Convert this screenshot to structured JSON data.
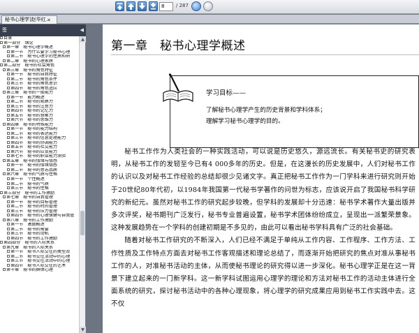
{
  "toolbar": {
    "current_page": "8",
    "total_pages": "/ 287"
  },
  "tab": {
    "title": "秘书心理学]赵华红...",
    "close": "✕"
  },
  "sidebar": {
    "title": "签",
    "collapse": "◀",
    "items": [
      {
        "level": 0,
        "exp": true,
        "label": "目录"
      },
      {
        "level": 0,
        "exp": true,
        "label": "第一部分　绪论"
      },
      {
        "level": 1,
        "exp": true,
        "label": "第一章　秘书心理学概述"
      },
      {
        "level": 2,
        "exp": true,
        "label": "第一节　为什么要学习秘书心理"
      },
      {
        "level": 2,
        "exp": true,
        "label": "第二节　秘书心理学的性质和研"
      },
      {
        "level": 1,
        "exp": true,
        "label": "第二章　秘书的心理素质"
      },
      {
        "level": 0,
        "exp": true,
        "label": "第二部分　秘书的社会角色"
      },
      {
        "level": 1,
        "exp": true,
        "label": "第三章　秘书的角色特征"
      },
      {
        "level": 2,
        "exp": true,
        "label": "第一节　秘书的自我特征"
      },
      {
        "level": 2,
        "exp": true,
        "label": "第二节　秘书的角色条件"
      },
      {
        "level": 2,
        "exp": true,
        "label": "第三节　秘书的角色意识"
      },
      {
        "level": 2,
        "exp": true,
        "label": "第四节　秘书的角色适应"
      },
      {
        "level": 1,
        "exp": true,
        "label": "第三章　秘书的一般能力"
      },
      {
        "level": 2,
        "exp": true,
        "label": "第一节　能力概述"
      },
      {
        "level": 2,
        "exp": true,
        "label": "第二节　秘书的观察力"
      },
      {
        "level": 2,
        "exp": true,
        "label": "第三节　秘书的注意力"
      },
      {
        "level": 2,
        "exp": true,
        "label": "第四节　秘书的记忆力"
      },
      {
        "level": 2,
        "exp": true,
        "label": "第五节　秘书的想象力"
      },
      {
        "level": 2,
        "exp": true,
        "label": "第六节　秘书的思维力"
      },
      {
        "level": 1,
        "exp": true,
        "label": "第四章　秘书的特殊能力"
      },
      {
        "level": 2,
        "exp": true,
        "label": "第一节　秘书的能力结构"
      },
      {
        "level": 2,
        "exp": true,
        "label": "第二节　秘书的表达能力"
      },
      {
        "level": 2,
        "exp": true,
        "label": "第三节　秘书的信息处理能力"
      },
      {
        "level": 2,
        "exp": true,
        "label": "第四节　秘书的协调能力"
      },
      {
        "level": 2,
        "exp": true,
        "label": "第五节　秘书的社交能力"
      },
      {
        "level": 2,
        "exp": true,
        "label": "第六节　秘书的应变能力"
      },
      {
        "level": 2,
        "exp": true,
        "label": "第七节　秘书的职业能力测验"
      },
      {
        "level": 1,
        "exp": true,
        "label": "第五章　秘书的情绪与情感"
      },
      {
        "level": 2,
        "exp": true,
        "label": "第一节　秘书的情绪情感"
      },
      {
        "level": 2,
        "exp": true,
        "label": "第二节　秘书的意志品质"
      },
      {
        "level": 1,
        "exp": true,
        "label": "第六章　秘书的气质与性格"
      },
      {
        "level": 2,
        "exp": true,
        "label": "第一节　个性概述"
      },
      {
        "level": 2,
        "exp": true,
        "label": "第二节　秘书的气质"
      },
      {
        "level": 2,
        "exp": true,
        "label": "第三节　秘书的性格"
      },
      {
        "level": 0,
        "exp": true,
        "label": "第三部分　秘书的工作激励"
      },
      {
        "level": 1,
        "exp": true,
        "label": "第七章　秘书的自我管理"
      },
      {
        "level": 2,
        "exp": true,
        "label": "第一节　秘书的目标管理"
      },
      {
        "level": 2,
        "exp": true,
        "label": "第二节　秘书的时间管理"
      },
      {
        "level": 2,
        "exp": true,
        "label": "第三节　秘书的压力管理"
      },
      {
        "level": 2,
        "exp": true,
        "label": "第四节　秘书的心理保健与自我管"
      },
      {
        "level": 1,
        "exp": true,
        "label": "第八章　秘书的工作激励"
      },
      {
        "level": 2,
        "exp": true,
        "label": "第一节　激励概述"
      },
      {
        "level": 2,
        "exp": true,
        "label": "第二节　秘书的需要"
      },
      {
        "level": 2,
        "exp": true,
        "label": "第三节　秘书的动机"
      },
      {
        "level": 2,
        "exp": true,
        "label": "第四节　秘书的工作激励"
      },
      {
        "level": 0,
        "exp": true,
        "label": "第四部分　秘书的人际关系"
      },
      {
        "level": 1,
        "exp": true,
        "label": "第九章　秘书的人际关系"
      },
      {
        "level": 2,
        "exp": true,
        "label": "第一节　秘书人际交往的类型及"
      },
      {
        "level": 2,
        "exp": true,
        "label": "第二节　秘书交往活动中的心理"
      },
      {
        "level": 2,
        "exp": true,
        "label": "第三节　秘书交往活动中的心理"
      },
      {
        "level": 2,
        "exp": true,
        "label": "第四节　秘书人际交往的艺术"
      },
      {
        "level": 1,
        "exp": true,
        "label": "第十章　秘书的群体心理"
      }
    ]
  },
  "page": {
    "chapter_title": "第一章　秘书心理学概述",
    "objectives": {
      "title": "学习目标——",
      "lines": [
        "了解秘书心理学产生的历史背景和学科体系；",
        "理解学习秘书心理学的目的。"
      ]
    },
    "paragraphs": [
      "秘书工作作为人类社会的一种实践活动，可以说是历史悠久，源远流长。有关秘书史的研究表明，从秘书工作的发轫至今已有4 000多年的历史。但是，在这漫长的历史发展中，人们对秘书工作的认识以及对秘书工作经验的总结却很少见诸文字。真正把秘书工作作为一门学科来进行研究则开始于20世纪80年代初，以1984年我国第一代秘书学著作的问世为标志，应该说开启了我国秘书科学研究的新纪元。虽然对秘书工作的研究起步较晚，但学科的发展却十分迅速：秘书学术著作大量出版并多次评奖，秘书期刊广泛发行，秘书专业普遍设置，秘书学术团体纷纷成立，呈现出一派繁荣景象。这种发展趋势在一个学科的创建初期是不多见的，由此可以看出秘书学科具有广泛的社会基础。",
      "随着对秘书工作研究的不断深入，人们已经不满足于单纯从工作内容、工作程序、工作方法、工作性质及工作特点方面去对秘书工作客观描述和理论总结了，而逐渐开始把研究的焦点对准从事秘书工作的人，对准秘书活动的主体，从而使秘书理论的研究得以进一步深化。秘书心理学正是在这一背景下建立起来的一门新学科。这一新学科试图运用心理学的理论和方法对秘书工作的活动主体进行全面系统的研究，探讨秘书活动中的各种心理现象，将心理学的研究成果应用到秘书工作实践中去。这不仅"
    ]
  }
}
